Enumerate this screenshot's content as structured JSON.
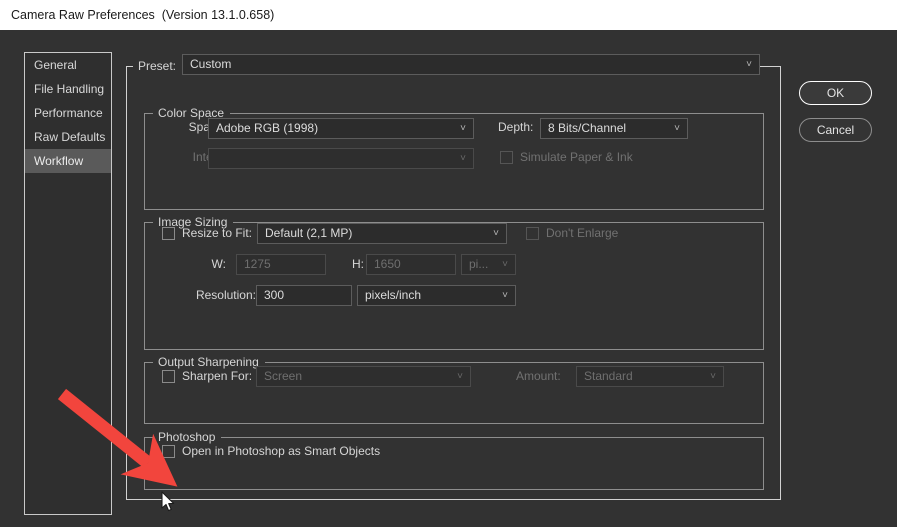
{
  "window": {
    "title": "Camera Raw Preferences  (Version 13.1.0.658)"
  },
  "sidebar": {
    "items": [
      {
        "label": "General",
        "selected": false
      },
      {
        "label": "File Handling",
        "selected": false
      },
      {
        "label": "Performance",
        "selected": false
      },
      {
        "label": "Raw Defaults",
        "selected": false
      },
      {
        "label": "Workflow",
        "selected": true
      }
    ]
  },
  "preset": {
    "label": "Preset:",
    "value": "Custom"
  },
  "color_space": {
    "legend": "Color Space",
    "space_label": "Space:",
    "space_value": "Adobe RGB (1998)",
    "depth_label": "Depth:",
    "depth_value": "8 Bits/Channel",
    "intent_label": "Intent:",
    "intent_value": "",
    "simulate_label": "Simulate Paper & Ink",
    "simulate_checked": false
  },
  "image_sizing": {
    "legend": "Image Sizing",
    "resize_label": "Resize to Fit:",
    "resize_checked": false,
    "resize_value": "Default  (2,1 MP)",
    "dont_enlarge_label": "Don't Enlarge",
    "dont_enlarge_checked": false,
    "w_label": "W:",
    "w_value": "1275",
    "h_label": "H:",
    "h_value": "1650",
    "unit_value": "pi...",
    "resolution_label": "Resolution:",
    "resolution_value": "300",
    "resolution_unit": "pixels/inch"
  },
  "output_sharpening": {
    "legend": "Output Sharpening",
    "sharpen_label": "Sharpen For:",
    "sharpen_checked": false,
    "sharpen_value": "Screen",
    "amount_label": "Amount:",
    "amount_value": "Standard"
  },
  "photoshop": {
    "legend": "Photoshop",
    "smart_objects_label": "Open in Photoshop as Smart Objects",
    "smart_objects_checked": false
  },
  "buttons": {
    "ok": "OK",
    "cancel": "Cancel"
  },
  "annotation": {
    "arrow_color": "#f2453d",
    "points_to": "Open in Photoshop as Smart Objects"
  },
  "icons": {
    "chevron": "˅"
  },
  "colors": {
    "dialog_background": "#323232",
    "titlebar_background": "#ffffff",
    "selected_sidebar_item": "#5a5a5a",
    "field_background": "#2c2c2c",
    "field_border": "#5c5c5c",
    "text": "#d6d6d6",
    "disabled_text": "#717171",
    "arrow_red": "#f2453d"
  }
}
